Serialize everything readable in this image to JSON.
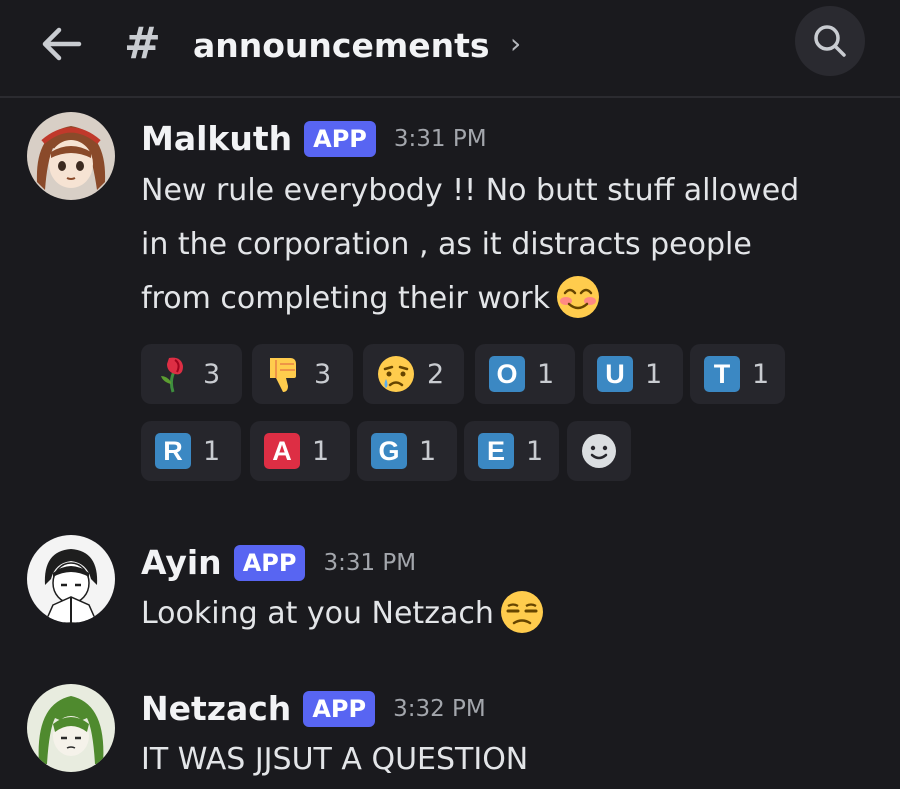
{
  "header": {
    "back_icon": "arrow-left-icon",
    "hash_symbol": "#",
    "channel": "announcements",
    "chevron": "›",
    "search_icon": "search-icon"
  },
  "messages": [
    {
      "username": "Malkuth",
      "badge": "APP",
      "time": "3:31 PM",
      "lines": [
        "New rule everybody !! No butt stuff allowed",
        "in the corporation , as it distracts people",
        "from completing their work"
      ],
      "emoji": "smiling-face-with-blush",
      "reactions": [
        {
          "emoji": "wilted-flower",
          "count": "3"
        },
        {
          "emoji": "thumbs-down",
          "count": "3"
        },
        {
          "emoji": "crying-face",
          "count": "2"
        },
        {
          "letter": "O",
          "count": "1"
        },
        {
          "letter": "U",
          "count": "1"
        },
        {
          "letter": "T",
          "count": "1"
        },
        {
          "letter": "R",
          "count": "1"
        },
        {
          "letter": "A",
          "count": "1"
        },
        {
          "letter": "G",
          "count": "1"
        },
        {
          "letter": "E",
          "count": "1"
        }
      ],
      "add_reaction_icon": "add-reaction-icon"
    },
    {
      "username": "Ayin",
      "badge": "APP",
      "time": "3:31 PM",
      "lines": [
        "Looking at you Netzach"
      ],
      "emoji": "unamused-face"
    },
    {
      "username": "Netzach",
      "badge": "APP",
      "time": "3:32 PM",
      "lines": [
        "IT WAS JJSUT A QUESTION"
      ]
    }
  ],
  "colors": {
    "background": "#1a1a1e",
    "app_badge": "#5865f2",
    "tile_blue": "#3b88c3",
    "tile_red": "#dd2e44"
  }
}
